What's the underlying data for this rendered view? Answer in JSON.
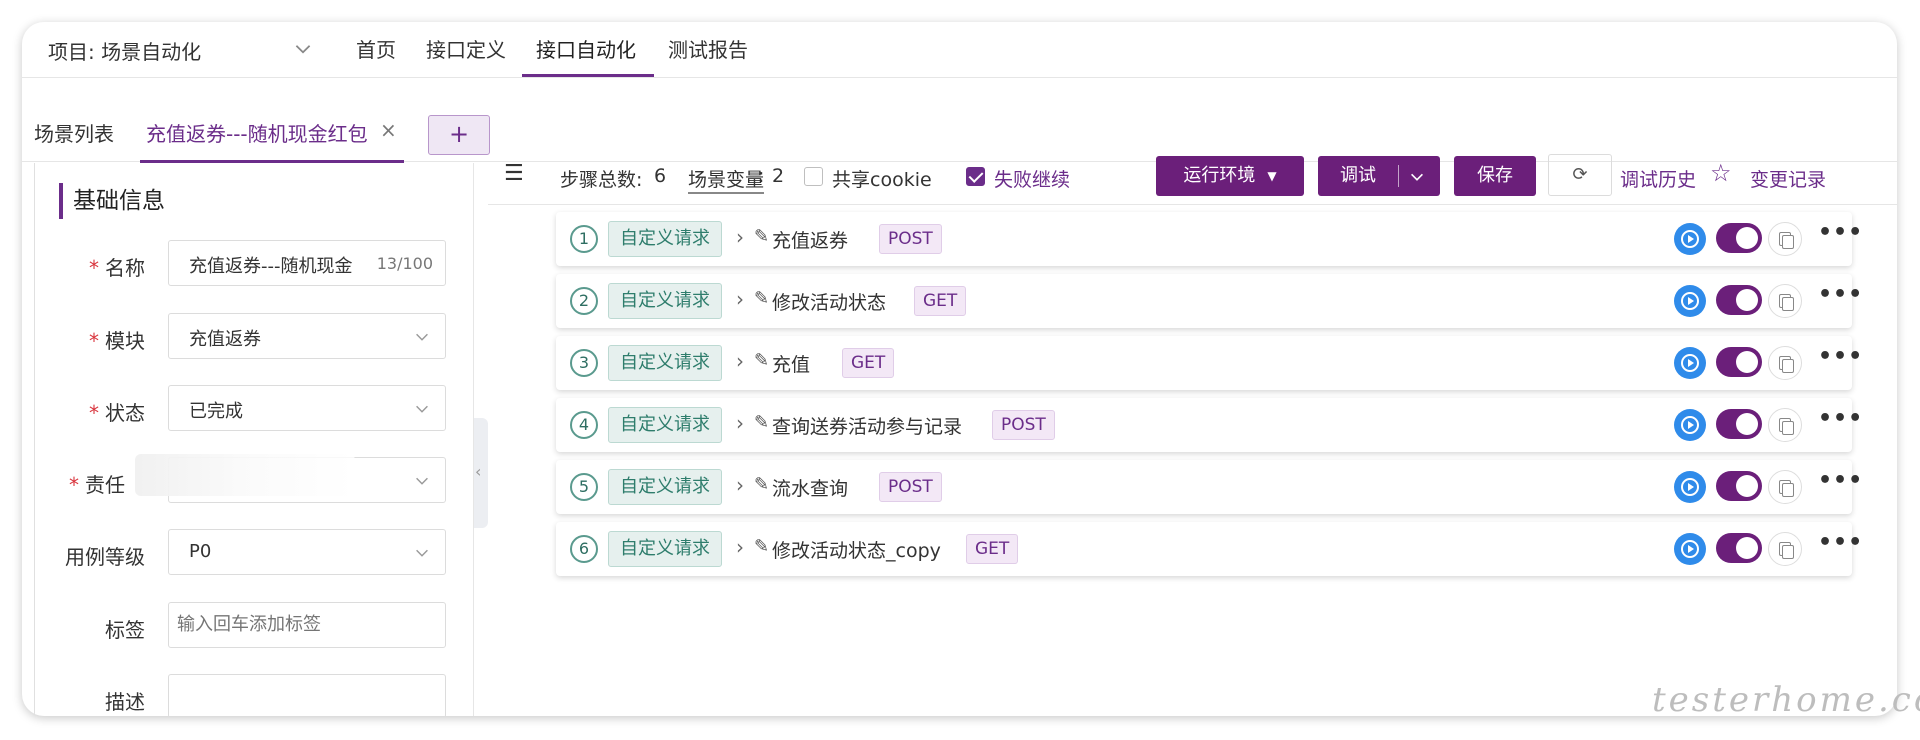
{
  "header": {
    "project_label": "项目: 场景自动化",
    "nav": [
      "首页",
      "接口定义",
      "接口自动化",
      "测试报告"
    ],
    "active_nav": "接口自动化"
  },
  "tabs": {
    "list_label": "场景列表",
    "active_tab": "充值返券---随机现金红包",
    "close": "×",
    "add": "+"
  },
  "form": {
    "section_title": "基础信息",
    "name_label": "名称",
    "name_value": "充值返券---随机现金",
    "name_count": "13/100",
    "module_label": "模块",
    "module_value": "充值返券",
    "status_label": "状态",
    "status_value": "已完成",
    "owner_label": "责任",
    "level_label": "用例等级",
    "level_value": "P0",
    "tags_label": "标签",
    "tags_placeholder": "输入回车添加标签",
    "desc_label": "描述"
  },
  "toolbar": {
    "steps_label": "步骤总数:",
    "steps_count": "6",
    "vars_label": "场景变量",
    "vars_sep": ":",
    "vars_count": "2",
    "share_cookie": "共享cookie",
    "share_cookie_checked": false,
    "fail_continue": "失败继续",
    "fail_continue_checked": true,
    "env_button": "运行环境",
    "debug_button": "调试",
    "save_button": "保存",
    "history_link": "调试历史",
    "changes_link": "变更记录"
  },
  "steps": [
    {
      "index": "1",
      "type": "自定义请求",
      "name": "充值返券",
      "method": "POST",
      "enabled": true
    },
    {
      "index": "2",
      "type": "自定义请求",
      "name": "修改活动状态",
      "method": "GET",
      "enabled": true
    },
    {
      "index": "3",
      "type": "自定义请求",
      "name": "充值",
      "method": "GET",
      "enabled": true
    },
    {
      "index": "4",
      "type": "自定义请求",
      "name": "查询送券活动参与记录",
      "method": "POST",
      "enabled": true
    },
    {
      "index": "5",
      "type": "自定义请求",
      "name": "流水查询",
      "method": "POST",
      "enabled": true
    },
    {
      "index": "6",
      "type": "自定义请求",
      "name": "修改活动状态_copy",
      "method": "GET",
      "enabled": true
    }
  ],
  "watermark": "testerhome.com",
  "colors": {
    "primary": "#6b1f7a",
    "tag_green": "#2e7d6c",
    "play_blue": "#2f8bea"
  }
}
